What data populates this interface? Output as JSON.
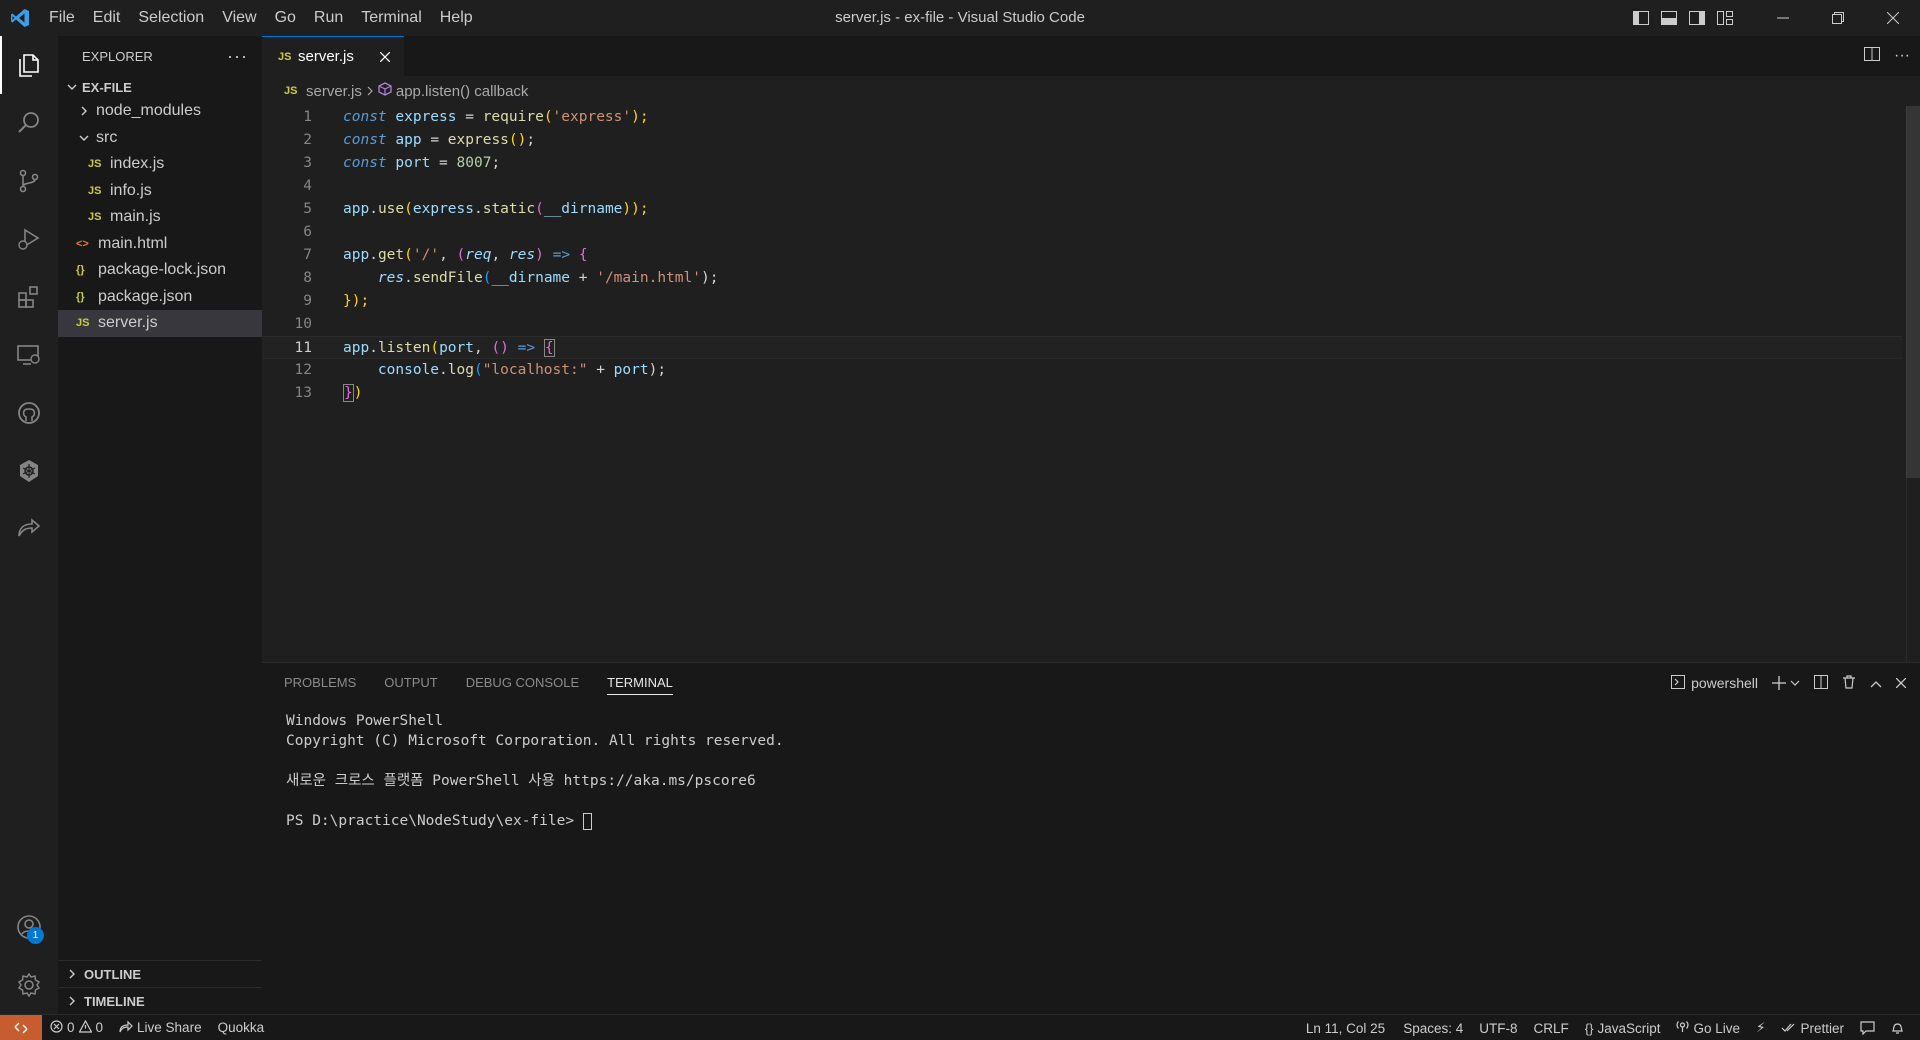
{
  "window": {
    "title": "server.js - ex-file - Visual Studio Code"
  },
  "menu": [
    "File",
    "Edit",
    "Selection",
    "View",
    "Go",
    "Run",
    "Terminal",
    "Help"
  ],
  "activity": {
    "items": [
      "explorer-icon",
      "search-icon",
      "source-control-icon",
      "run-debug-icon",
      "extensions-icon",
      "remote-explorer-icon",
      "github-icon",
      "kubernetes-icon",
      "live-share-icon"
    ],
    "accounts_badge": "1"
  },
  "sidebar": {
    "title": "EXPLORER",
    "folder": "EX-FILE",
    "tree": [
      {
        "label": "node_modules",
        "type": "folder",
        "icon": "chevron-right"
      },
      {
        "label": "src",
        "type": "folder",
        "icon": "chevron-down"
      },
      {
        "label": "index.js",
        "type": "js",
        "icon": "JS"
      },
      {
        "label": "info.js",
        "type": "js",
        "icon": "JS"
      },
      {
        "label": "main.js",
        "type": "js",
        "icon": "JS"
      },
      {
        "label": "main.html",
        "type": "html",
        "icon": "<>"
      },
      {
        "label": "package-lock.json",
        "type": "json",
        "icon": "{}"
      },
      {
        "label": "package.json",
        "type": "json",
        "icon": "{}"
      },
      {
        "label": "server.js",
        "type": "js",
        "icon": "JS",
        "selected": true
      }
    ],
    "outline": "OUTLINE",
    "timeline": "TIMELINE"
  },
  "editor": {
    "tab": {
      "icon": "JS",
      "label": "server.js"
    },
    "breadcrumb": {
      "icon": "JS",
      "file": "server.js",
      "symbol": "app.listen() callback"
    },
    "line_numbers": [
      "1",
      "2",
      "3",
      "4",
      "5",
      "6",
      "7",
      "8",
      "9",
      "10",
      "11",
      "12",
      "13"
    ],
    "current_line": "11",
    "code": {
      "l1": [
        "const",
        "express",
        "=",
        "require",
        "(",
        "'express'",
        ");"
      ],
      "l2": [
        "const",
        "app",
        "=",
        "express",
        "()",
        ";"
      ],
      "l3": [
        "const",
        "port",
        "=",
        "8007",
        ";"
      ],
      "l5": [
        "app",
        ".",
        "use",
        "(",
        "express",
        ".",
        "static",
        "(",
        "__dirname",
        "));"
      ],
      "l7": [
        "app",
        ".",
        "get",
        "(",
        "'/'",
        ", ",
        "(",
        "req",
        ", ",
        "res",
        ")",
        " => ",
        "{"
      ],
      "l8": [
        "res",
        ".",
        "sendFile",
        "(",
        "__dirname",
        " + ",
        "'/main.html'",
        ");"
      ],
      "l9": [
        "});"
      ],
      "l11": [
        "app",
        ".",
        "listen",
        "(",
        "port",
        ", ",
        "()",
        " => ",
        "{"
      ],
      "l12": [
        "console",
        ".",
        "log",
        "(",
        "\"localhost:\"",
        " + ",
        "port",
        ");"
      ],
      "l13": [
        "}",
        ")"
      ]
    }
  },
  "panel": {
    "tabs": [
      "PROBLEMS",
      "OUTPUT",
      "DEBUG CONSOLE",
      "TERMINAL"
    ],
    "active_tab": "TERMINAL",
    "terminal_name": "powershell",
    "terminal_lines": [
      "Windows PowerShell",
      "Copyright (C) Microsoft Corporation. All rights reserved.",
      "",
      "새로운 크로스 플랫폼 PowerShell 사용 https://aka.ms/pscore6",
      "",
      "PS D:\\practice\\NodeStudy\\ex-file> "
    ]
  },
  "statusbar": {
    "errors": "0",
    "warnings": "0",
    "live_share": "Live Share",
    "quokka": "Quokka",
    "position": "Ln 11, Col 25",
    "spaces": "Spaces: 4",
    "encoding": "UTF-8",
    "eol": "CRLF",
    "language": "JavaScript",
    "go_live": "Go Live",
    "prettier": "Prettier",
    "colors": {
      "remote_bg": "#c75c2e",
      "accent": "#0078d4"
    }
  }
}
